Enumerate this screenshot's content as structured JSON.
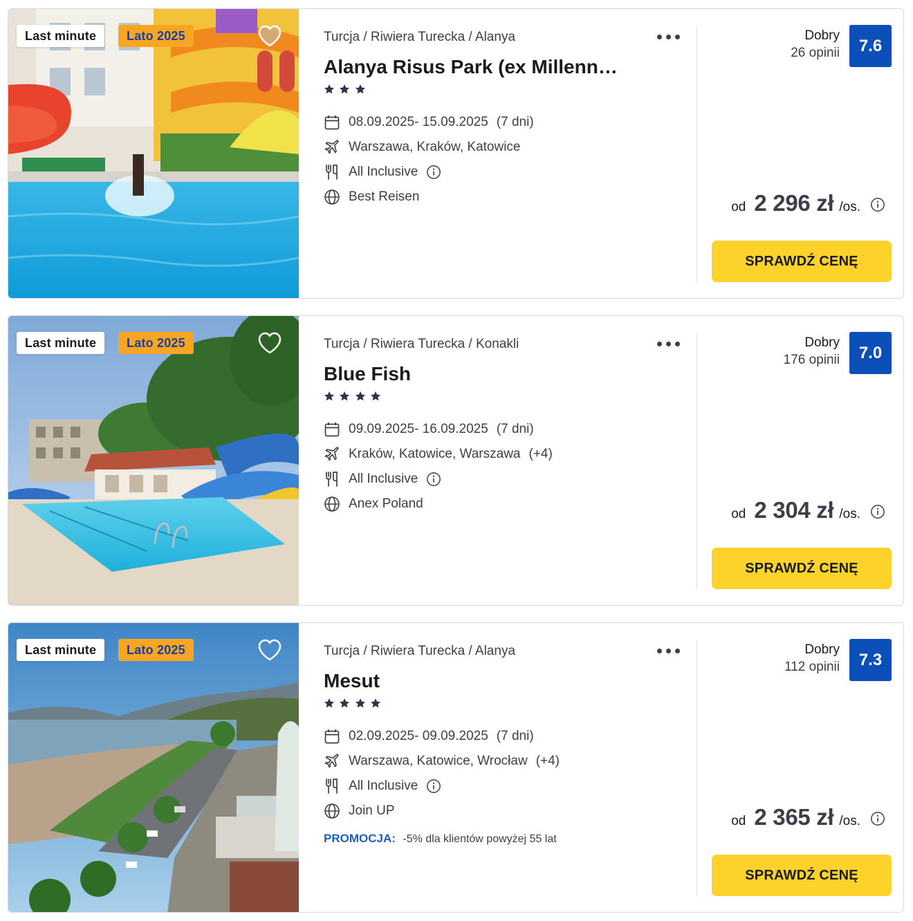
{
  "offers": [
    {
      "badges": {
        "last_minute": "Last minute",
        "season": "Lato 2025"
      },
      "breadcrumb": "Turcja / Riwiera Turecka / Alanya",
      "title": "Alanya Risus Park (ex Millennium)",
      "stars": 3,
      "dates": "08.09.2025- 15.09.2025",
      "duration": "(7 dni)",
      "departures": "Warszawa, Kraków, Katowice",
      "departures_extra": "",
      "board": "All Inclusive",
      "operator": "Best Reisen",
      "promo_label": "",
      "promo_text": "",
      "rating_word": "Dobry",
      "rating_count": "26 opinii",
      "score": "7.6",
      "price_prefix": "od",
      "price": "2 296 zł",
      "price_suffix": "/os.",
      "cta": "SPRAWDŹ CENĘ",
      "heart_filled": true,
      "photo_icon": "hotel-pool-waterslide-photo"
    },
    {
      "badges": {
        "last_minute": "Last minute",
        "season": "Lato 2025"
      },
      "breadcrumb": "Turcja / Riwiera Turecka / Konakli",
      "title": "Blue Fish",
      "stars": 4,
      "dates": "09.09.2025- 16.09.2025",
      "duration": "(7 dni)",
      "departures": "Kraków, Katowice, Warszawa",
      "departures_extra": "(+4)",
      "board": "All Inclusive",
      "operator": "Anex Poland",
      "promo_label": "",
      "promo_text": "",
      "rating_word": "Dobry",
      "rating_count": "176 opinii",
      "score": "7.0",
      "price_prefix": "od",
      "price": "2 304 zł",
      "price_suffix": "/os.",
      "cta": "SPRAWDŹ CENĘ",
      "heart_filled": false,
      "photo_icon": "hotel-pool-slides-photo"
    },
    {
      "badges": {
        "last_minute": "Last minute",
        "season": "Lato 2025"
      },
      "breadcrumb": "Turcja / Riwiera Turecka / Alanya",
      "title": "Mesut",
      "stars": 4,
      "dates": "02.09.2025- 09.09.2025",
      "duration": "(7 dni)",
      "departures": "Warszawa, Katowice, Wrocław",
      "departures_extra": "(+4)",
      "board": "All Inclusive",
      "operator": "Join UP",
      "promo_label": "PROMOCJA:",
      "promo_text": "-5% dla klientów powyżej 55 lat",
      "rating_word": "Dobry",
      "rating_count": "112 opinii",
      "score": "7.3",
      "price_prefix": "od",
      "price": "2 365 zł",
      "price_suffix": "/os.",
      "cta": "SPRAWDŹ CENĘ",
      "heart_filled": false,
      "photo_icon": "coastal-town-photo"
    }
  ],
  "colors": {
    "accent_yellow": "#fdd32b",
    "score_blue": "#0c4fb8",
    "season_badge_bg": "#f7a623",
    "season_badge_text": "#1d3f9a",
    "promo_blue": "#1e5fc4"
  }
}
